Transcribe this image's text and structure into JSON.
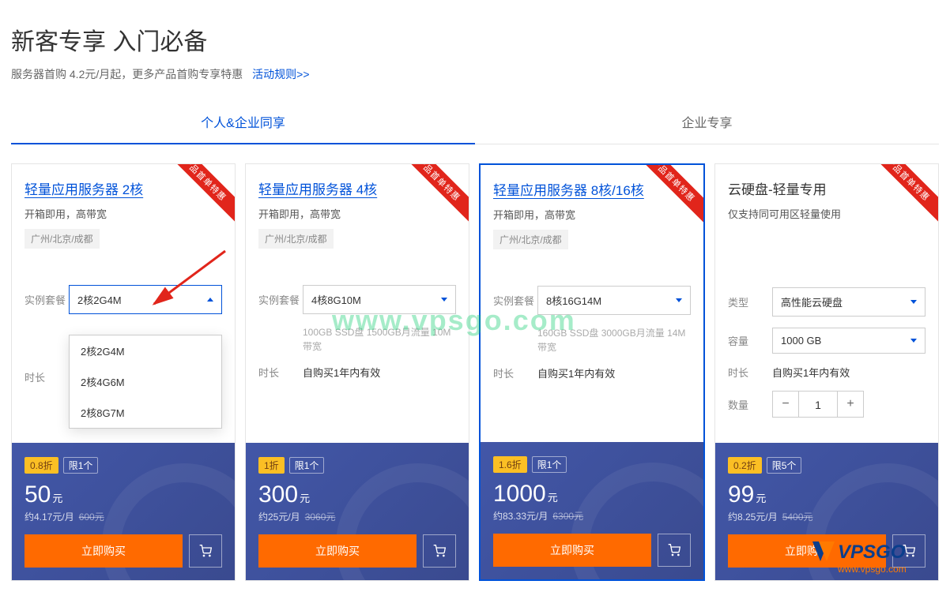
{
  "header": {
    "title": "新客专享 入门必备",
    "subtitle": "服务器首购 4.2元/月起，更多产品首购专享特惠",
    "rules_link": "活动规则>>"
  },
  "tabs": [
    {
      "label": "个人&企业同享",
      "active": true
    },
    {
      "label": "企业专享",
      "active": false
    }
  ],
  "ribbon_text": "产品首单特惠",
  "labels": {
    "package": "实例套餐",
    "duration": "时长",
    "type": "类型",
    "capacity": "容量",
    "quantity": "数量",
    "buy_now": "立即购买",
    "yuan": "元"
  },
  "cards": [
    {
      "title": "轻量应用服务器 2核",
      "desc": "开箱即用，高带宽",
      "region": "广州/北京/成都",
      "package_selected": "2核2G4M",
      "dropdown_open": true,
      "options": [
        "2核2G4M",
        "2核4G6M",
        "2核8G7M"
      ],
      "duration": "",
      "discount": "0.8折",
      "limit": "限1个",
      "price": "50",
      "per_month": "约4.17元/月",
      "original": "600元"
    },
    {
      "title": "轻量应用服务器 4核",
      "desc": "开箱即用，高带宽",
      "region": "广州/北京/成都",
      "package_selected": "4核8G10M",
      "spec_hint": "100GB SSD盘 1500GB月流量 10M带宽",
      "duration": "自购买1年内有效",
      "discount": "1折",
      "limit": "限1个",
      "price": "300",
      "per_month": "约25元/月",
      "original": "3060元"
    },
    {
      "title": "轻量应用服务器 8核/16核",
      "desc": "开箱即用，高带宽",
      "region": "广州/北京/成都",
      "package_selected": "8核16G14M",
      "spec_hint": "160GB SSD盘 3000GB月流量 14M带宽",
      "duration": "自购买1年内有效",
      "highlighted": true,
      "discount": "1.6折",
      "limit": "限1个",
      "price": "1000",
      "per_month": "约83.33元/月",
      "original": "6300元"
    },
    {
      "title": "云硬盘-轻量专用",
      "title_plain": true,
      "desc": "仅支持同可用区轻量使用",
      "type_selected": "高性能云硬盘",
      "capacity_selected": "1000 GB",
      "duration": "自购买1年内有效",
      "quantity": "1",
      "discount": "0.2折",
      "limit": "限5个",
      "price": "99",
      "per_month": "约8.25元/月",
      "original": "5400元"
    }
  ],
  "watermark": "www.vpsgo.com",
  "logo": {
    "text": "VPSGO",
    "url": "www.vpsgo.com"
  }
}
